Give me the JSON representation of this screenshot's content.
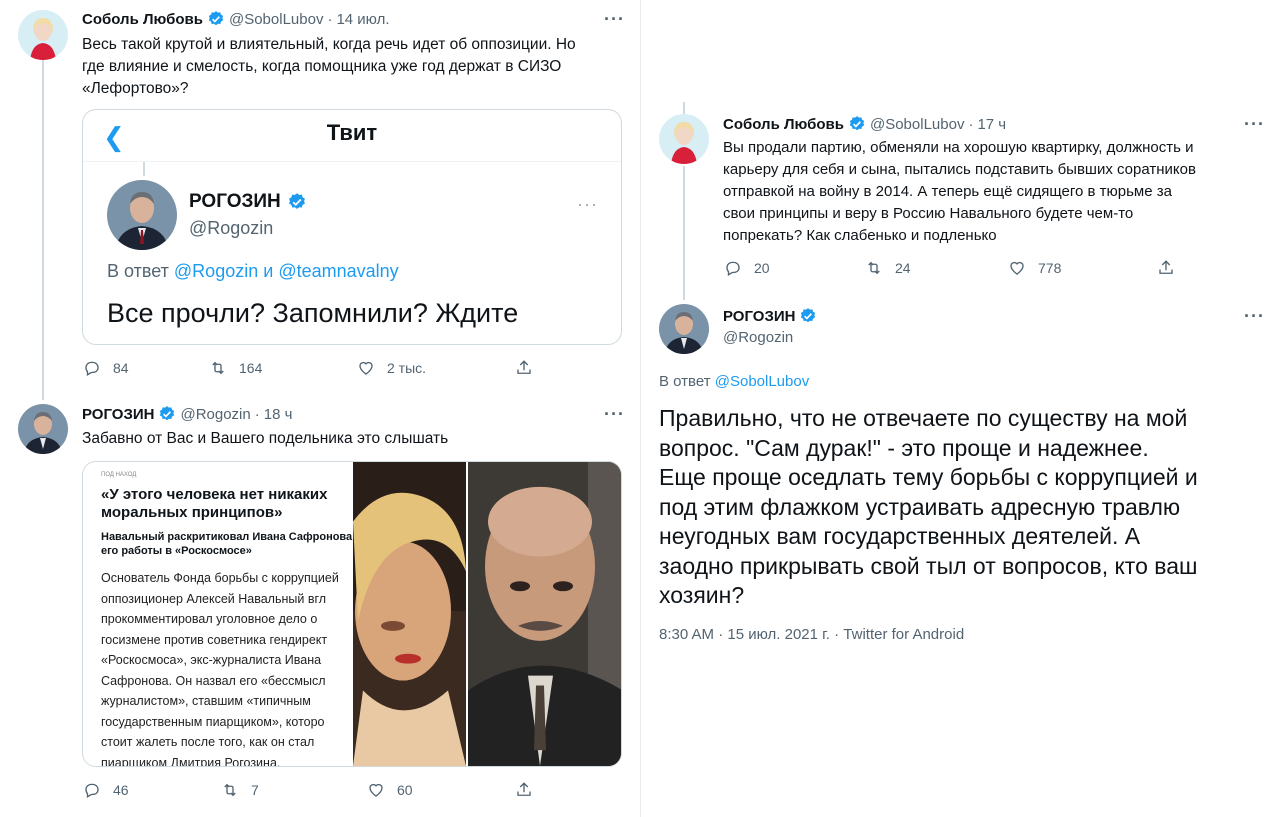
{
  "tweet1": {
    "name": "Соболь Любовь",
    "handle": "@SobolLubov",
    "time": "14 июл.",
    "text_lines": [
      "Весь такой крутой и влиятельный, когда речь идет об оппозиции. Но",
      "где влияние и смелость, когда помощника уже год держат в СИЗО",
      "«Лефортово»?"
    ],
    "quote": {
      "back_icon": "chevron-left-icon",
      "title": "Твит",
      "name": "РОГОЗИН",
      "handle": "@Rogozin",
      "reply_prefix": "В ответ",
      "reply_to_1": "@Rogozin",
      "reply_and": "и",
      "reply_to_2": "@teamnavalny",
      "text": "Все прочли? Запомнили? Ждите"
    },
    "replies": "84",
    "retweets": "164",
    "likes": "2 тыс."
  },
  "tweet2": {
    "name": "РОГОЗИН",
    "handle": "@Rogozin",
    "time": "18 ч",
    "text": "Забавно от Вас и Вашего подельника это слышать",
    "article": {
      "kicker": "ПОД НАХОД",
      "headline_lines": [
        "«У этого человека нет никаких",
        "моральных принципов»"
      ],
      "sub_lines": [
        "Навальный раскритиковал Ивана Сафронова после",
        "его работы в «Роскосмосе»"
      ],
      "body_lines": [
        "Основатель Фонда борьбы с коррупцией",
        "оппозиционер Алексей Навальный вгл",
        "прокомментировал уголовное дело о",
        "госизмене против советника гендирект",
        "«Роскосмоса», экс-журналиста Ивана",
        "Сафронова. Он назвал его «бессмысл",
        "журналистом», ставшим «типичным",
        "государственным пиарщиком», которо",
        "стоит жалеть после того, как он стал",
        "пиарщиком Дмитрия Рогозина."
      ]
    },
    "replies": "46",
    "retweets": "7",
    "likes": "60"
  },
  "tweet3": {
    "name": "Соболь Любовь",
    "handle": "@SobolLubov",
    "time": "17 ч",
    "text_lines": [
      "Вы продали партию, обменяли на хорошую квартирку, должность и",
      "карьеру для себя и сына, пытались подставить бывших соратников",
      "отправкой на войну в 2014. А теперь ещё сидящего в тюрьме за",
      "свои принципы и веру в Россию Навального будете чем-то",
      "попрекать? Как слабенько и подленько"
    ],
    "replies": "20",
    "retweets": "24",
    "likes": "778"
  },
  "tweet4": {
    "name": "РОГОЗИН",
    "handle": "@Rogozin",
    "reply_prefix": "В ответ",
    "reply_to": "@SobolLubov",
    "text_lines": [
      "Правильно, что не отвечаете по существу на мой",
      "вопрос. \"Сам дурак!\" - это проще и надежнее.",
      "Еще проще оседлать тему борьбы с коррупцией и",
      "под этим флажком устраивать адресную травлю",
      "неугодных вам государственных деятелей. А",
      "заодно прикрывать свой тыл от вопросов, кто ваш",
      "хозяин?"
    ],
    "meta": "8:30 AM · 15 июл. 2021 г. · Twitter for Android"
  },
  "colors": {
    "accent": "#1d9bf0",
    "text": "#0f1419",
    "secondary": "#536471",
    "border": "#cfd9de"
  }
}
